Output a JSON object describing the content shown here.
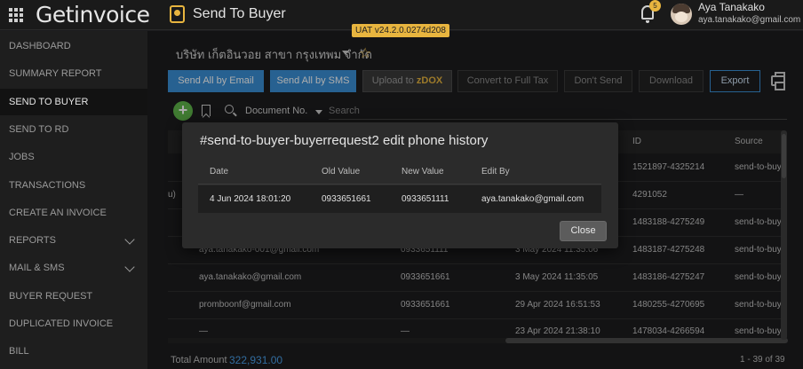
{
  "app": {
    "logo_text": "Getinvoice",
    "page_title": "Send To Buyer",
    "version_badge": "UAT v24.2.0.0274d208",
    "notification_count": "5",
    "user_name": "Aya Tanakako",
    "user_email": "aya.tanakako@gmail.com"
  },
  "sidebar": {
    "items": [
      {
        "label": "DASHBOARD"
      },
      {
        "label": "SUMMARY REPORT"
      },
      {
        "label": "SEND TO BUYER",
        "active": true
      },
      {
        "label": "SEND TO RD"
      },
      {
        "label": "JOBS"
      },
      {
        "label": "TRANSACTIONS"
      },
      {
        "label": "CREATE AN INVOICE"
      },
      {
        "label": "REPORTS",
        "expandable": true
      },
      {
        "label": "MAIL & SMS",
        "expandable": true
      },
      {
        "label": "BUYER REQUEST"
      },
      {
        "label": "DUPLICATED INVOICE"
      },
      {
        "label": "BILL"
      }
    ]
  },
  "main": {
    "company_name": "บริษัท เก็ตอินวอย สาขา กรุงเทพม จำกัด",
    "toolbar": {
      "send_email": "Send All by Email",
      "send_sms": "Send All by SMS",
      "upload_prefix": "Upload to ",
      "upload_brand_z": "z",
      "upload_brand_d": "D",
      "upload_brand_rest": "OX",
      "convert": "Convert to Full Tax",
      "dont_send": "Don't Send",
      "download": "Download",
      "export": "Export"
    },
    "filter": {
      "field": "Document No.",
      "placeholder": "Search"
    },
    "table": {
      "columns": {
        "id": "ID",
        "source": "Source"
      },
      "rows": [
        {
          "col1": "",
          "phone": "",
          "date": "",
          "id": "1521897-4325214",
          "source": "send-to-buy"
        },
        {
          "col1": "u)",
          "phone": "",
          "date": "",
          "id": "4291052",
          "source": "—"
        },
        {
          "col1": "",
          "phone": "",
          "date": "",
          "id": "1483188-4275249",
          "source": "send-to-buy"
        },
        {
          "col1": "aya.tanakako-001@gmail.com",
          "phone": "0933651111",
          "date": "3 May 2024 11:35:06",
          "id": "1483187-4275248",
          "source": "send-to-buy"
        },
        {
          "col1": "aya.tanakako@gmail.com",
          "phone": "0933651661",
          "date": "3 May 2024 11:35:05",
          "id": "1483186-4275247",
          "source": "send-to-buy"
        },
        {
          "col1": "promboonf@gmail.com",
          "phone": "0933651661",
          "date": "29 Apr 2024 16:51:53",
          "id": "1480255-4270695",
          "source": "send-to-buy"
        },
        {
          "col1": "—",
          "phone": "—",
          "date": "23 Apr 2024 21:38:10",
          "id": "1478034-4266594",
          "source": "send-to-buy"
        }
      ]
    },
    "footer": {
      "total_label": "Total Amount",
      "total_value": "322,931.00",
      "pager": "1 - 39 of 39"
    }
  },
  "modal": {
    "title": "#send-to-buyer-buyerrequest2 edit phone history",
    "columns": {
      "date": "Date",
      "old": "Old Value",
      "new": "New Value",
      "by": "Edit By"
    },
    "rows": [
      {
        "date": "4 Jun 2024 18:01:20",
        "old": "0933651661",
        "new": "0933651111",
        "by": "aya.tanakako@gmail.com"
      }
    ],
    "close_label": "Close"
  }
}
